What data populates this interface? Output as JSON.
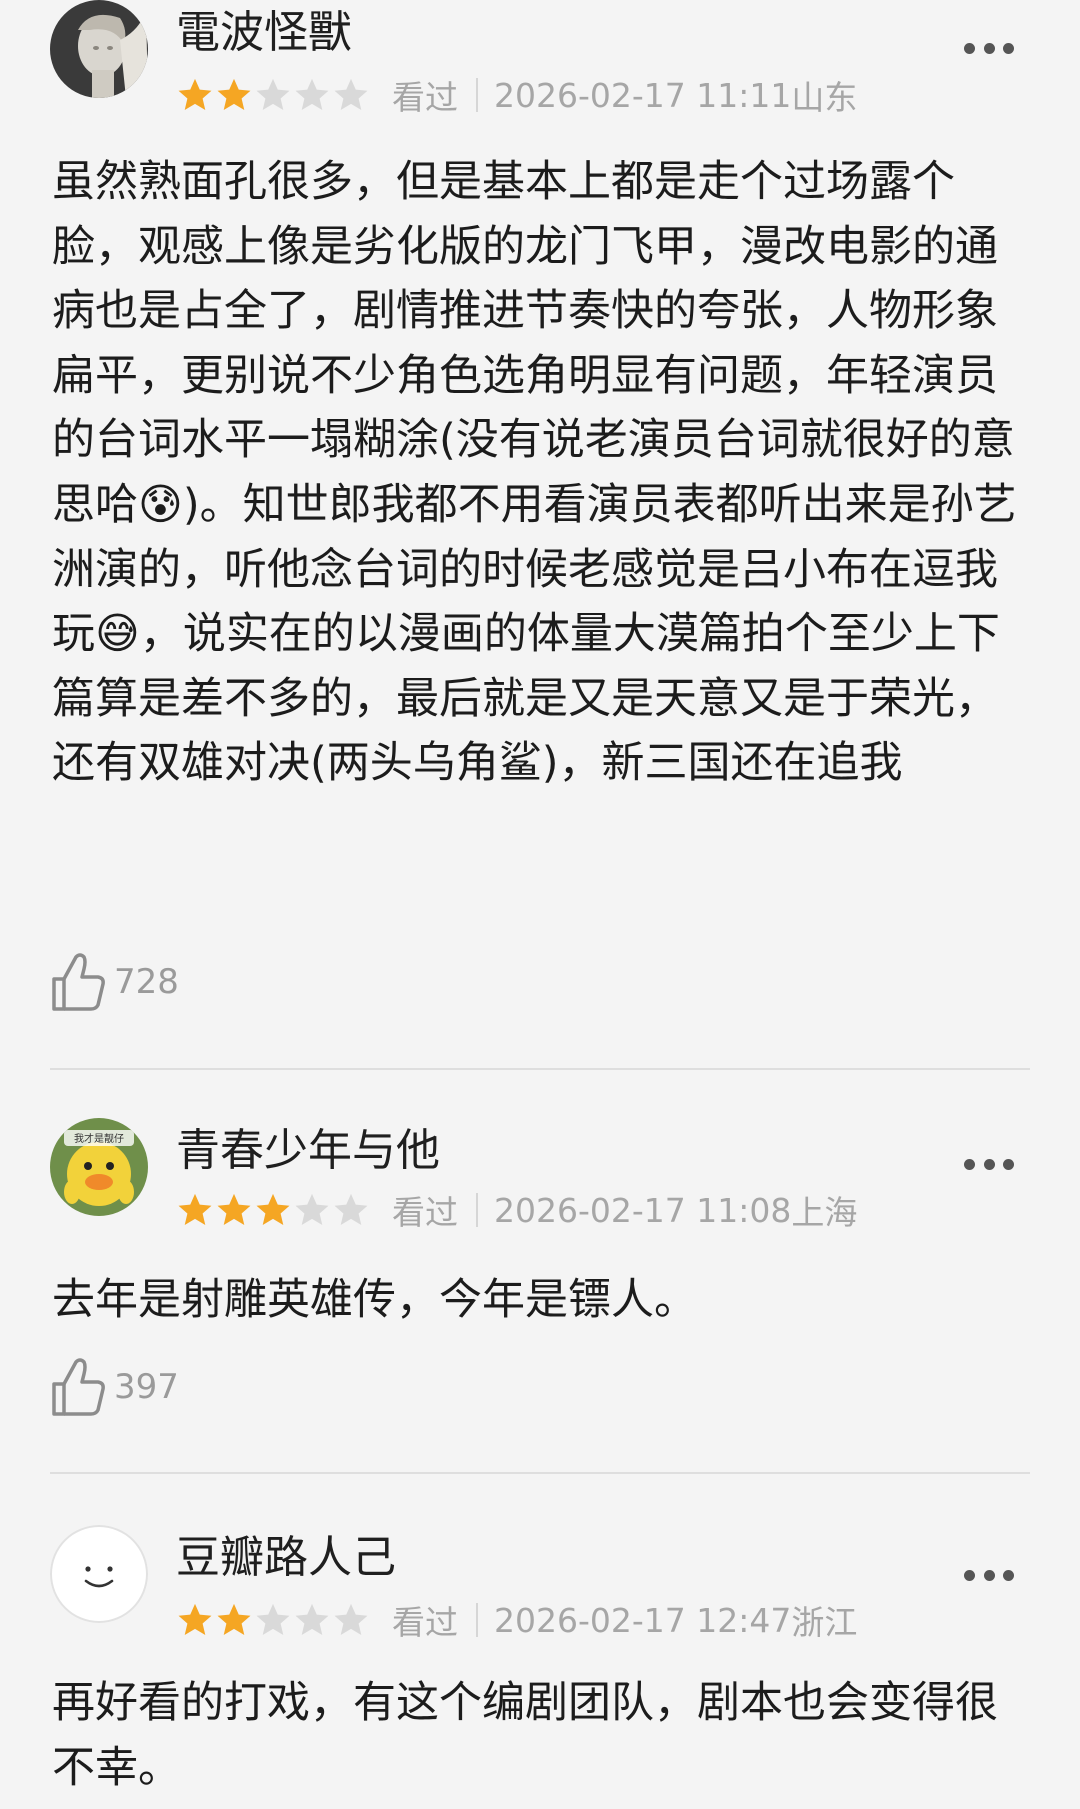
{
  "colors": {
    "background": "#f4f4f4",
    "star_filled": "#f5a623",
    "star_empty": "#d9d9d9",
    "meta_text": "#a6a6a6",
    "body_text": "#1c1c1c"
  },
  "reviews": [
    {
      "username": "電波怪獸",
      "avatar": "statue-avatar",
      "rating": 2,
      "rating_max": 5,
      "status": "看过",
      "time": "2026-02-17 11:11",
      "region": "山东",
      "text": "虽然熟面孔很多，但是基本上都是走个过场露个脸，观感上像是劣化版的龙门飞甲，漫改电影的通病也是占全了，剧情推进节奏快的夸张，人物形象扁平，更别说不少角色选角明显有问题，年轻演员的台词水平一塌糊涂(没有说老演员台词就很好的意思哈😰)。知世郎我都不用看演员表都听出来是孙艺洲演的，听他念台词的时候老感觉是吕小布在逗我玩😅，说实在的以漫画的体量大漠篇拍个至少上下篇算是差不多的，最后就是又是天意又是于荣光，还有双雄对决(两头乌角鲨)，新三国还在追我",
      "likes": "728"
    },
    {
      "username": "青春少年与他",
      "avatar": "yellow-duck-avatar",
      "avatar_caption": "我才是靓仔",
      "rating": 3,
      "rating_max": 5,
      "status": "看过",
      "time": "2026-02-17 11:08",
      "region": "上海",
      "text": "去年是射雕英雄传，今年是镖人。",
      "likes": "397"
    },
    {
      "username": "豆瓣路人己",
      "avatar": "smiley-avatar",
      "rating": 2,
      "rating_max": 5,
      "status": "看过",
      "time": "2026-02-17 12:47",
      "region": "浙江",
      "text": "再好看的打戏，有这个编剧团队，剧本也会变得很不幸。",
      "likes": ""
    }
  ]
}
